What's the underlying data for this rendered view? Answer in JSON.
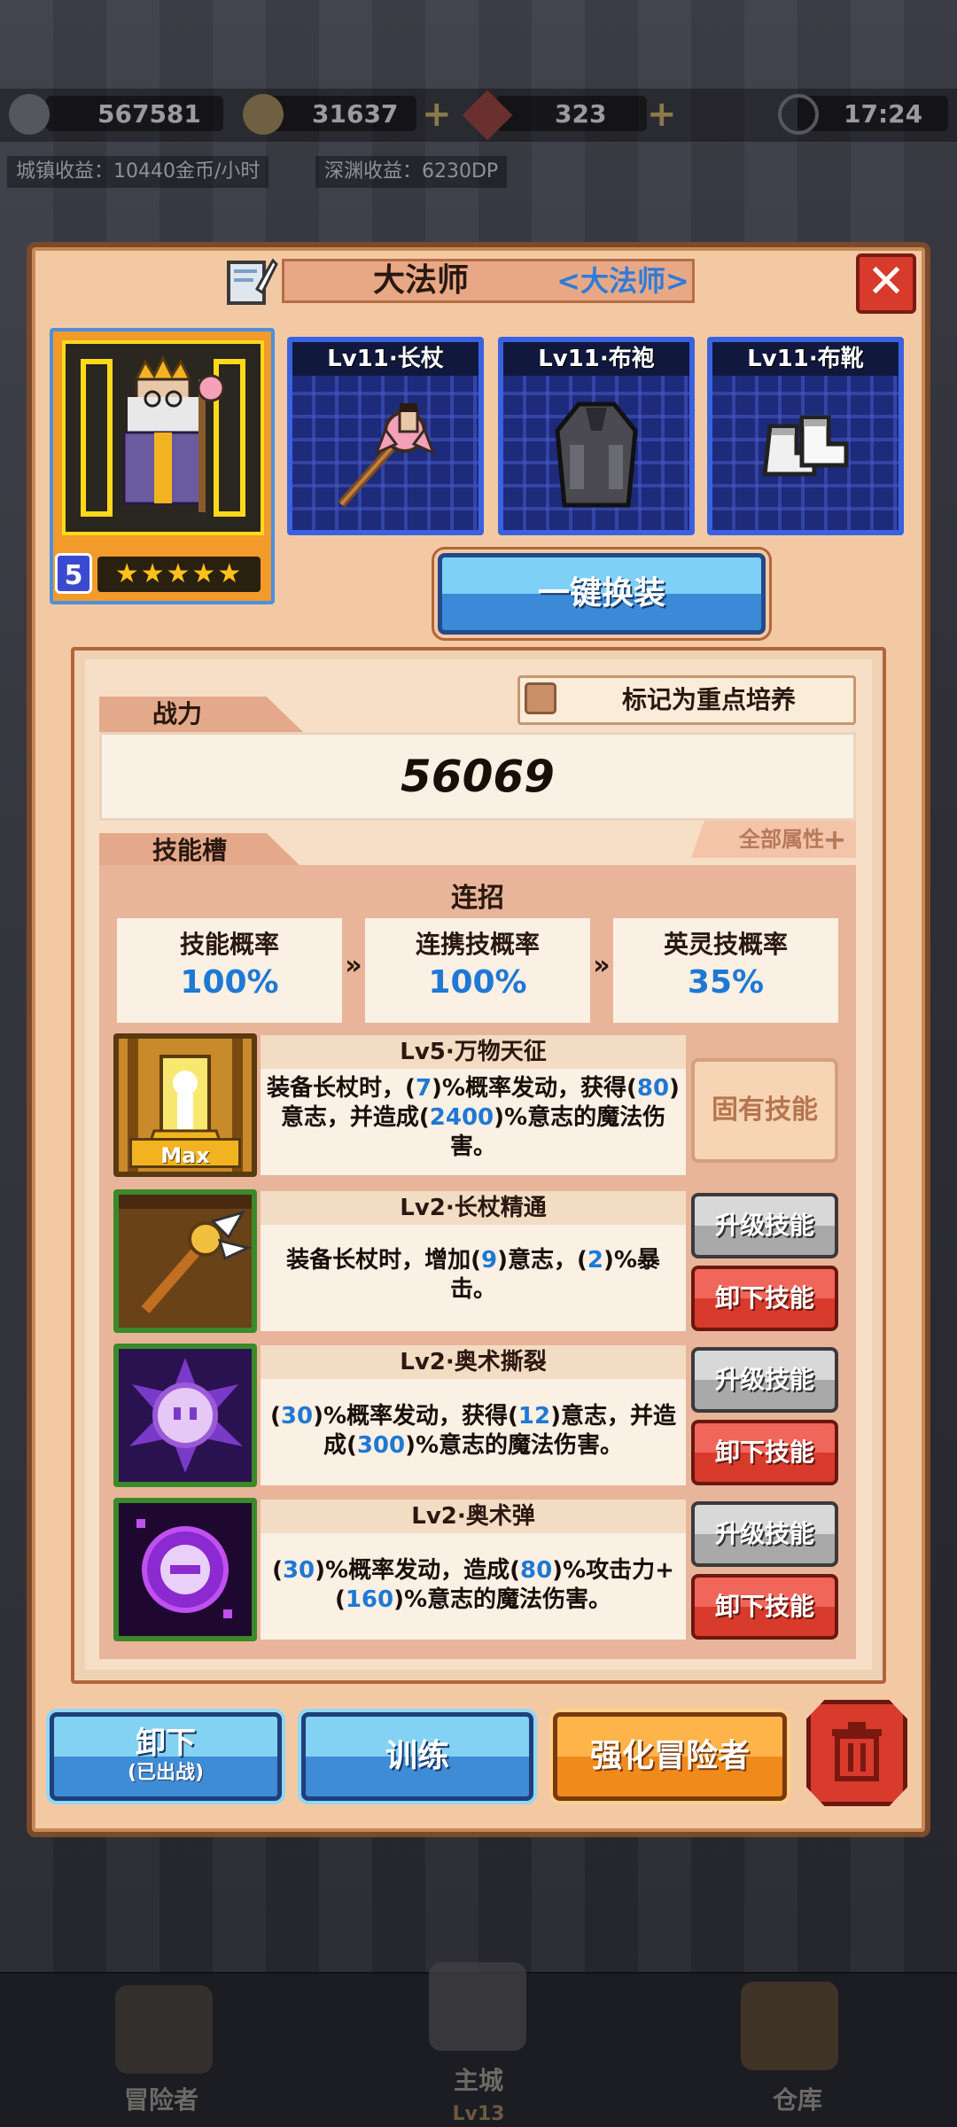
{
  "status_bar": {
    "power": "567581",
    "gold": "31637",
    "gems": "323",
    "time": "17:24",
    "town_income": "城镇收益：10440金币/小时",
    "abyss_income": "深渊收益：6230DP"
  },
  "hero": {
    "name": "大法师",
    "class": "<大法师>",
    "level": "5",
    "stars": "★★★★★",
    "close": "✕"
  },
  "equipment": [
    {
      "label": "Lv11·长杖"
    },
    {
      "label": "Lv11·布袍"
    },
    {
      "label": "Lv11·布靴"
    }
  ],
  "one_key_equip": "一键换装",
  "focus_label": "标记为重点培养",
  "power_tab": "战力",
  "power_value": "56069",
  "skills_tab": "技能槽",
  "all_attributes": "全部属性",
  "combo": {
    "title": "连招",
    "items": [
      {
        "name": "技能概率",
        "value": "100%"
      },
      {
        "name": "连携技概率",
        "value": "100%"
      },
      {
        "name": "英灵技概率",
        "value": "35%"
      }
    ],
    "arrow": "»"
  },
  "skills": [
    {
      "title": "Lv5·万物天征",
      "badge": "Max",
      "desc_parts": [
        "装备长杖时，(",
        "7",
        ")%概率发动，获得(",
        "80",
        ")意志，并造成(",
        "2400",
        ")%意志的魔法伤害。"
      ],
      "fixed_label": "固有技能"
    },
    {
      "title": "Lv2·长杖精通",
      "desc_parts": [
        "装备长杖时，增加(",
        "9",
        ")意志，(",
        "2",
        ")%暴击。"
      ],
      "upgrade": "升级技能",
      "unequip": "卸下技能"
    },
    {
      "title": "Lv2·奥术撕裂",
      "desc_parts": [
        "(",
        "30",
        ")%概率发动，获得(",
        "12",
        ")意志，并造成(",
        "300",
        ")%意志的魔法伤害。"
      ],
      "upgrade": "升级技能",
      "unequip": "卸下技能"
    },
    {
      "title": "Lv2·奥术弹",
      "desc_parts": [
        "(",
        "30",
        ")%概率发动，造成(",
        "80",
        ")%攻击力+(",
        "160",
        ")%意志的魔法伤害。"
      ],
      "upgrade": "升级技能",
      "unequip": "卸下技能"
    }
  ],
  "bottom_buttons": {
    "unequip": "卸下",
    "unequip_sub": "(已出战)",
    "train": "训练",
    "enhance": "强化冒险者"
  },
  "nav": {
    "adventurer": "冒险者",
    "main_city": "主城",
    "main_city_level": "Lv13",
    "warehouse": "仓库"
  },
  "colors": {
    "panel": "#f3c9a4",
    "accent_blue": "#1f78d4",
    "danger_red": "#d83a2c",
    "enhance_orange": "#f08a1a"
  }
}
